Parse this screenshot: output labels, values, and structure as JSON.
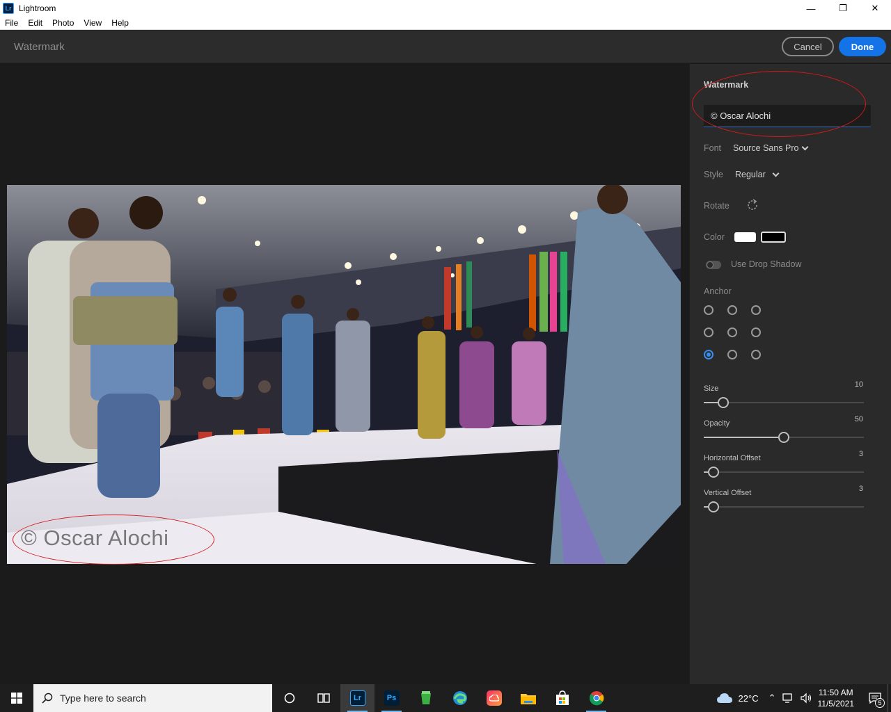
{
  "window": {
    "title": "Lightroom",
    "controls": [
      "—",
      "❐",
      "✕"
    ]
  },
  "menu": [
    "File",
    "Edit",
    "Photo",
    "View",
    "Help"
  ],
  "header": {
    "title": "Watermark",
    "cancel_label": "Cancel",
    "done_label": "Done"
  },
  "photo": {
    "watermark_text": "© Oscar Alochi"
  },
  "panel": {
    "heading": "Watermark",
    "watermark_value": "© Oscar Alochi",
    "font_label": "Font",
    "font_value": "Source Sans Pro",
    "style_label": "Style",
    "style_value": "Regular",
    "rotate_label": "Rotate",
    "color_label": "Color",
    "swatch_colors": [
      "#ffffff",
      "#000000"
    ],
    "drop_shadow_label": "Use Drop Shadow",
    "drop_shadow_on": false,
    "anchor_label": "Anchor",
    "anchor_selected": "bottom-left",
    "sliders": [
      {
        "label": "Size",
        "value": "10",
        "fraction": 0.12
      },
      {
        "label": "Opacity",
        "value": "50",
        "fraction": 0.5
      },
      {
        "label": "Horizontal Offset",
        "value": "3",
        "fraction": 0.06
      },
      {
        "label": "Vertical Offset",
        "value": "3",
        "fraction": 0.06
      }
    ]
  },
  "taskbar": {
    "search_placeholder": "Type here to search",
    "temperature": "22°C",
    "time": "11:50 AM",
    "date": "11/5/2021",
    "notification_count": "5",
    "apps": [
      "cortana-icon",
      "task-view-icon",
      "lightroom-icon",
      "photoshop-icon",
      "app-green-icon",
      "edge-icon",
      "creative-cloud-icon",
      "file-explorer-icon",
      "store-icon",
      "chrome-icon"
    ]
  },
  "colors": {
    "accent": "#1473e6",
    "annotation": "#d11a1a"
  }
}
